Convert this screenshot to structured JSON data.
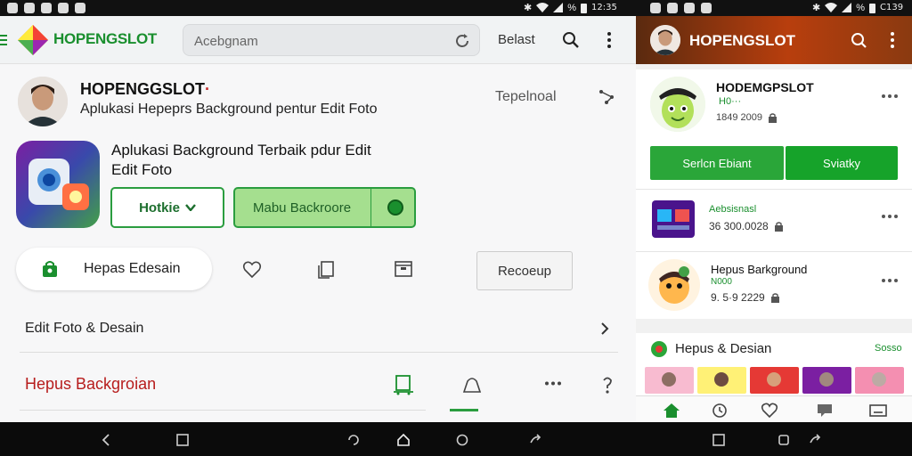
{
  "status_bar": {
    "battery": "%",
    "time": "12:35",
    "right_time": "C139"
  },
  "left": {
    "brand": "HOPENGSLOT",
    "search_placeholder": "Acebgnam",
    "top_link": "Belast",
    "developer": {
      "name": "HOPENGGSLOT",
      "name_suffix": "·",
      "subtitle": "Aplukasi Hepeprs Background pentur Edit Foto",
      "right_label": "Tepelnoal"
    },
    "app": {
      "title_line1": "Aplukasi Background Terbaik pdur Edit",
      "title_line2": "Edit Foto",
      "button_outline": "Hotkie",
      "button_green": "Mabu Backroore"
    },
    "pill_label": "Hepas Edesain",
    "rect_button": "Recoeup",
    "row1_label": "Edit Foto & Desain",
    "row2_label": "Hepus Backgroian"
  },
  "right": {
    "brand": "HOPENGSLOT",
    "card1": {
      "title": "HODEMGPSLOT",
      "subtitle": " H0···",
      "meta": "1849 2009"
    },
    "buttons": {
      "primary": "Serlcn Ebiant",
      "secondary": "Sviatky"
    },
    "card2": {
      "title": "Aebsisnasl",
      "meta": "36 300.0028"
    },
    "card3": {
      "title": "Hepus Barkground",
      "subtitle": "N000",
      "meta": "9. 5·9 2229"
    },
    "section": {
      "title": "Hepus & Desian",
      "link": "Sosso"
    }
  },
  "colors": {
    "brand_green": "#1a8f2e",
    "accent_red": "#b71c1c",
    "header_orange": "#b83e0d"
  }
}
